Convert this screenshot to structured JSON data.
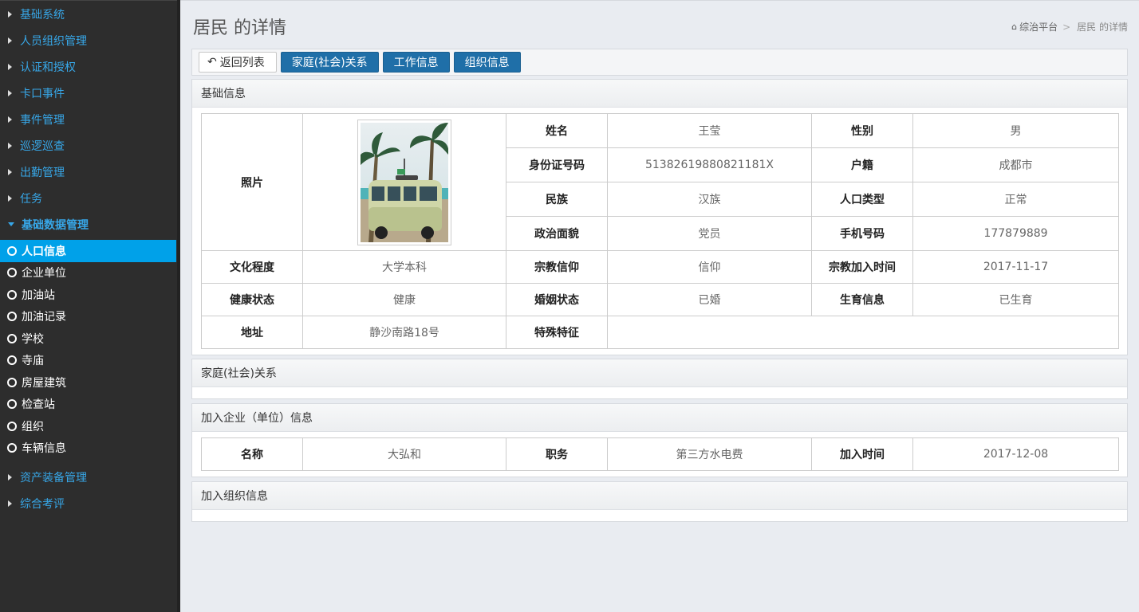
{
  "sidebar": {
    "groups_top": [
      {
        "label": "基础系统"
      },
      {
        "label": "人员组织管理"
      },
      {
        "label": "认证和授权"
      },
      {
        "label": "卡口事件"
      },
      {
        "label": "事件管理"
      },
      {
        "label": "巡逻巡查"
      },
      {
        "label": "出勤管理"
      },
      {
        "label": "任务"
      }
    ],
    "open_group": {
      "label": "基础数据管理"
    },
    "sub_items": [
      {
        "label": "人口信息",
        "active": true
      },
      {
        "label": "企业单位"
      },
      {
        "label": "加油站"
      },
      {
        "label": "加油记录"
      },
      {
        "label": "学校"
      },
      {
        "label": "寺庙"
      },
      {
        "label": "房屋建筑"
      },
      {
        "label": "检查站"
      },
      {
        "label": "组织"
      },
      {
        "label": "车辆信息"
      }
    ],
    "groups_bottom": [
      {
        "label": "资产装备管理"
      },
      {
        "label": "综合考评"
      }
    ]
  },
  "header": {
    "title": "居民  的详情",
    "breadcrumb_home": "综治平台",
    "breadcrumb_sep": ">",
    "breadcrumb_current": "居民 的详情"
  },
  "toolbar": {
    "back_label": "返回列表",
    "family_label": "家庭(社会)关系",
    "work_label": "工作信息",
    "org_label": "组织信息"
  },
  "basic": {
    "heading": "基础信息",
    "photo_label": "照片",
    "name_label": "姓名",
    "name": "王莹",
    "gender_label": "性别",
    "gender": "男",
    "id_label": "身份证号码",
    "id": "51382619880821181X",
    "hukou_label": "户籍",
    "hukou": "成都市",
    "ethnic_label": "民族",
    "ethnic": "汉族",
    "poptype_label": "人口类型",
    "poptype": "正常",
    "political_label": "政治面貌",
    "political": "党员",
    "phone_label": "手机号码",
    "phone": "177879889",
    "edu_label": "文化程度",
    "edu": "大学本科",
    "religion_label": "宗教信仰",
    "religion": "信仰",
    "religion_time_label": "宗教加入时间",
    "religion_time": "2017-11-17",
    "health_label": "健康状态",
    "health": "健康",
    "marital_label": "婚姻状态",
    "marital": "已婚",
    "birth_label": "生育信息",
    "birth": "已生育",
    "address_label": "地址",
    "address": "静沙南路18号",
    "feature_label": "特殊特征",
    "feature": ""
  },
  "family": {
    "heading": "家庭(社会)关系"
  },
  "company": {
    "heading": "加入企业（单位）信息",
    "name_label": "名称",
    "name": "大弘和",
    "post_label": "职务",
    "post": "第三方水电费",
    "join_label": "加入时间",
    "join": "2017-12-08"
  },
  "organization": {
    "heading": "加入组织信息"
  },
  "colors": {
    "sidebar_bg": "#2d2d2d",
    "nav_link": "#37a7e8",
    "active_item": "#00a1e9",
    "primary_button": "#1f6fa8"
  },
  "icons": {
    "caret": "caret-right-icon",
    "ring": "circle-outline-icon",
    "home": "home-icon",
    "back": "reply-arrow-icon"
  }
}
